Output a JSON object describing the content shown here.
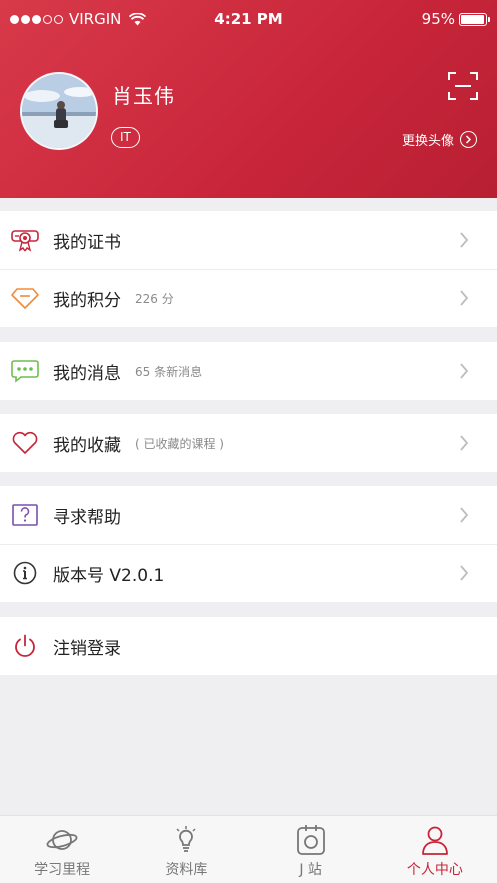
{
  "status_bar": {
    "carrier": "VIRGIN",
    "time": "4:21 PM",
    "battery": "95%",
    "battery_level": 0.95
  },
  "profile": {
    "name": "肖玉伟",
    "tag": "IT",
    "change_avatar": "更换头像"
  },
  "menu": {
    "certificates": {
      "label": "我的证书",
      "icon": "certificate-icon"
    },
    "points": {
      "label": "我的积分",
      "sub": "226 分",
      "icon": "diamond-icon"
    },
    "messages": {
      "label": "我的消息",
      "sub": "65 条新消息",
      "icon": "message-icon"
    },
    "favorites": {
      "label": "我的收藏",
      "sub": "( 已收藏的课程 )",
      "icon": "heart-icon"
    },
    "help": {
      "label": "寻求帮助",
      "icon": "question-icon"
    },
    "version": {
      "label": "版本号 V2.0.1",
      "icon": "info-icon"
    },
    "logout": {
      "label": "注销登录",
      "icon": "power-icon"
    }
  },
  "tabs": [
    {
      "label": "学习里程",
      "icon": "planet-icon"
    },
    {
      "label": "资料库",
      "icon": "lightbulb-icon"
    },
    {
      "label": "J 站",
      "icon": "j-station-icon"
    },
    {
      "label": "个人中心",
      "icon": "person-icon",
      "active": true
    }
  ],
  "colors": {
    "header": "#c8253a",
    "active_tab": "#c8253a",
    "points_icon": "#f08c3a",
    "message_icon": "#6cbf4e",
    "favorite_icon": "#c8253a",
    "help_icon": "#7a4fb0"
  }
}
